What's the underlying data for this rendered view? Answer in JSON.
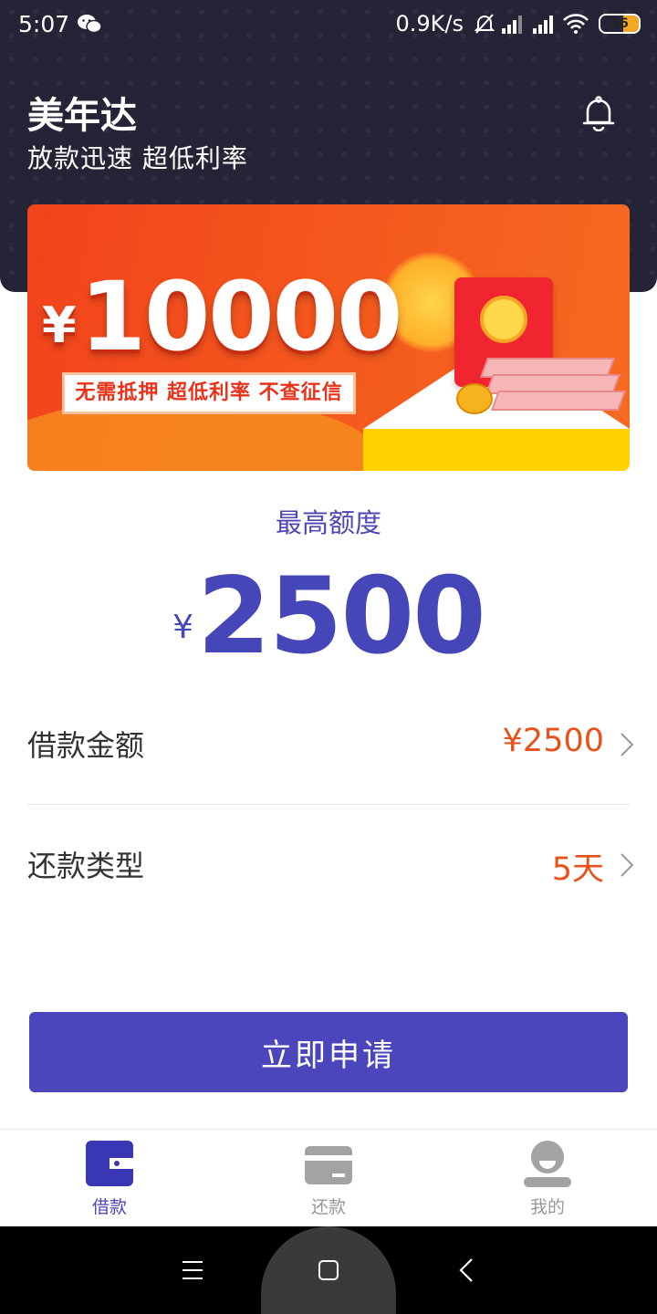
{
  "status_bar": {
    "time": "5:07",
    "net_speed": "0.9K/s",
    "battery": "46",
    "icons": [
      "wechat-icon",
      "mute-bell-icon",
      "signal-icon",
      "signal-icon",
      "wifi-icon",
      "battery-icon"
    ]
  },
  "header": {
    "title": "美年达",
    "subtitle": "放款迅速  超低利率",
    "bell_icon": "bell-icon"
  },
  "banner": {
    "currency": "¥",
    "amount": "10000",
    "tagline": "无需抵押 超低利率 不查征信"
  },
  "limit": {
    "label": "最高额度",
    "currency": "¥",
    "amount": "2500"
  },
  "form": {
    "loan_amount": {
      "label": "借款金额",
      "value": "¥2500"
    },
    "repay_type": {
      "label": "还款类型",
      "value": "5天"
    }
  },
  "apply_button": {
    "label": "立即申请"
  },
  "tabs": [
    {
      "label": "借款",
      "icon": "wallet-icon",
      "active": true
    },
    {
      "label": "还款",
      "icon": "card-icon",
      "active": false
    },
    {
      "label": "我的",
      "icon": "user-icon",
      "active": false
    }
  ],
  "colors": {
    "header_bg": "#252436",
    "primary": "#4b46bb",
    "accent_orange": "#e8521a",
    "banner_red": "#f2431c"
  }
}
